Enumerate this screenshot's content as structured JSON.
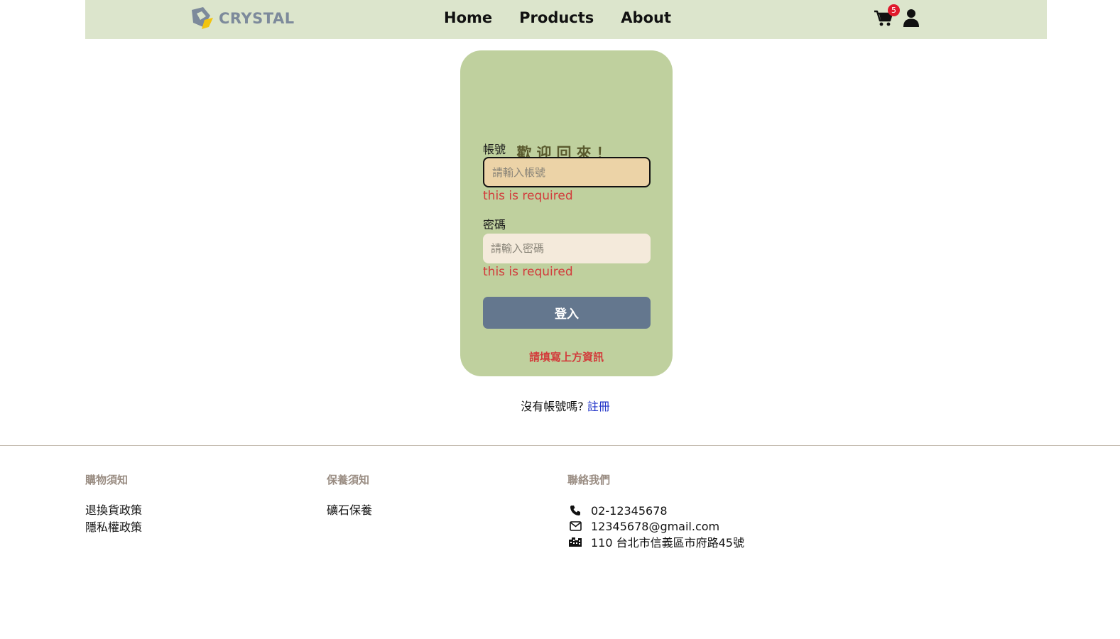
{
  "nav": {
    "logo_text": "CRYSTAL",
    "links": [
      "Home",
      "Products",
      "About"
    ],
    "cart_count": "5",
    "accent": "#dce5cc"
  },
  "login": {
    "title": "歡迎回來！",
    "account_label": "帳號",
    "account_placeholder": "請輸入帳號",
    "account_error": "this is required",
    "password_label": "密碼",
    "password_placeholder": "請輸入密碼",
    "password_error": "this is required",
    "submit_label": "登入",
    "form_message": "請填寫上方資訊",
    "card_color": "#bfd09e",
    "button_color": "#64778e",
    "error_color": "#d23b3b"
  },
  "register": {
    "prompt": "沒有帳號嗎?",
    "link": "註冊"
  },
  "footer": {
    "shopping": {
      "heading": "購物須知",
      "links": [
        "退換貨政策",
        "隱私權政策"
      ]
    },
    "care": {
      "heading": "保養須知",
      "links": [
        "礦石保養"
      ]
    },
    "contact": {
      "heading": "聯絡我們",
      "phone": "02-12345678",
      "email": "12345678@gmail.com",
      "address": "110 台北市信義區市府路45號"
    }
  },
  "icons": [
    "logo-gem-icon",
    "cart-icon",
    "user-icon",
    "phone-icon",
    "envelope-icon",
    "building-icon"
  ]
}
